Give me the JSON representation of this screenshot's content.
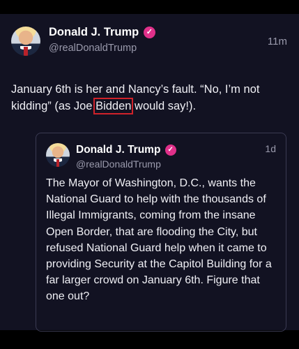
{
  "post": {
    "author_name": "Donald J. Trump",
    "handle": "@realDonaldTrump",
    "time": "11m",
    "text_before": "January 6th is her and Nancy’s fault. “No, I’m not kidding” (as Joe ",
    "text_highlight": "Bidden",
    "text_after": " would say!)."
  },
  "quoted_post": {
    "author_name": "Donald J. Trump",
    "handle": "@realDonaldTrump",
    "time": "1d",
    "text": "The Mayor of Washington, D.C., wants the National Guard to help with the thousands of Illegal Immigrants, coming from the insane Open Border, that are flooding the City, but refused National Guard help when it came to providing Security at the Capitol Building for a far larger crowd on January 6th. Figure that one out?"
  },
  "icons": {
    "verified": "verified-badge-icon",
    "avatar": "profile-photo"
  },
  "colors": {
    "background": "#121222",
    "verified_badge": "#e0308a",
    "highlight_box": "#d0222a"
  }
}
